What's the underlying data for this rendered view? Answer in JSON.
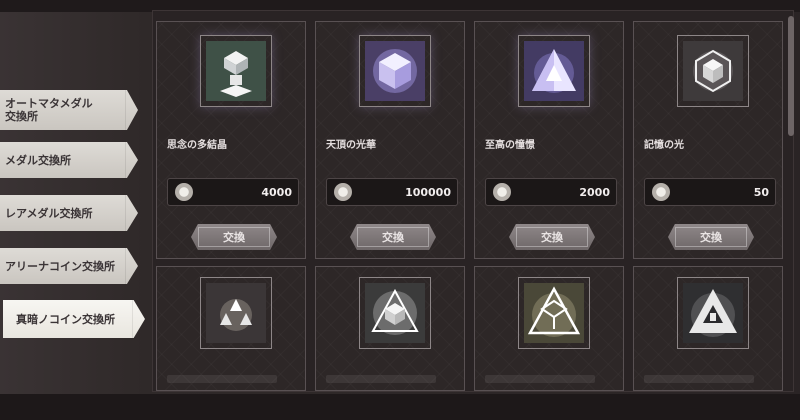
{
  "sidebar": {
    "tabs": [
      {
        "label": "オートマタメダル\n交換所"
      },
      {
        "label": "メダル交換所"
      },
      {
        "label": "レアメダル交換所"
      },
      {
        "label": "アリーナコイン交換所"
      },
      {
        "label": "真暗ノコイン交換所",
        "active": true
      }
    ]
  },
  "shop": {
    "items": [
      {
        "name": "思念の多結晶",
        "price": "4000",
        "button": "交換",
        "icon": "pedestal-crystal-icon"
      },
      {
        "name": "天頂の光華",
        "price": "100000",
        "button": "交換",
        "icon": "cube-crystal-icon"
      },
      {
        "name": "至高の憧憬",
        "price": "2000",
        "button": "交換",
        "icon": "pyramid-crystal-icon"
      },
      {
        "name": "記憶の光",
        "price": "50",
        "button": "交換",
        "icon": "hexagon-crystal-icon"
      }
    ],
    "lower_icons": [
      "triad-crystal-icon",
      "triangle-cube-icon",
      "large-triangle-icon",
      "dark-emblem-icon"
    ]
  },
  "colors": {
    "accent": "#e9e6df",
    "panel": "#292324",
    "button": "#7a7374"
  }
}
